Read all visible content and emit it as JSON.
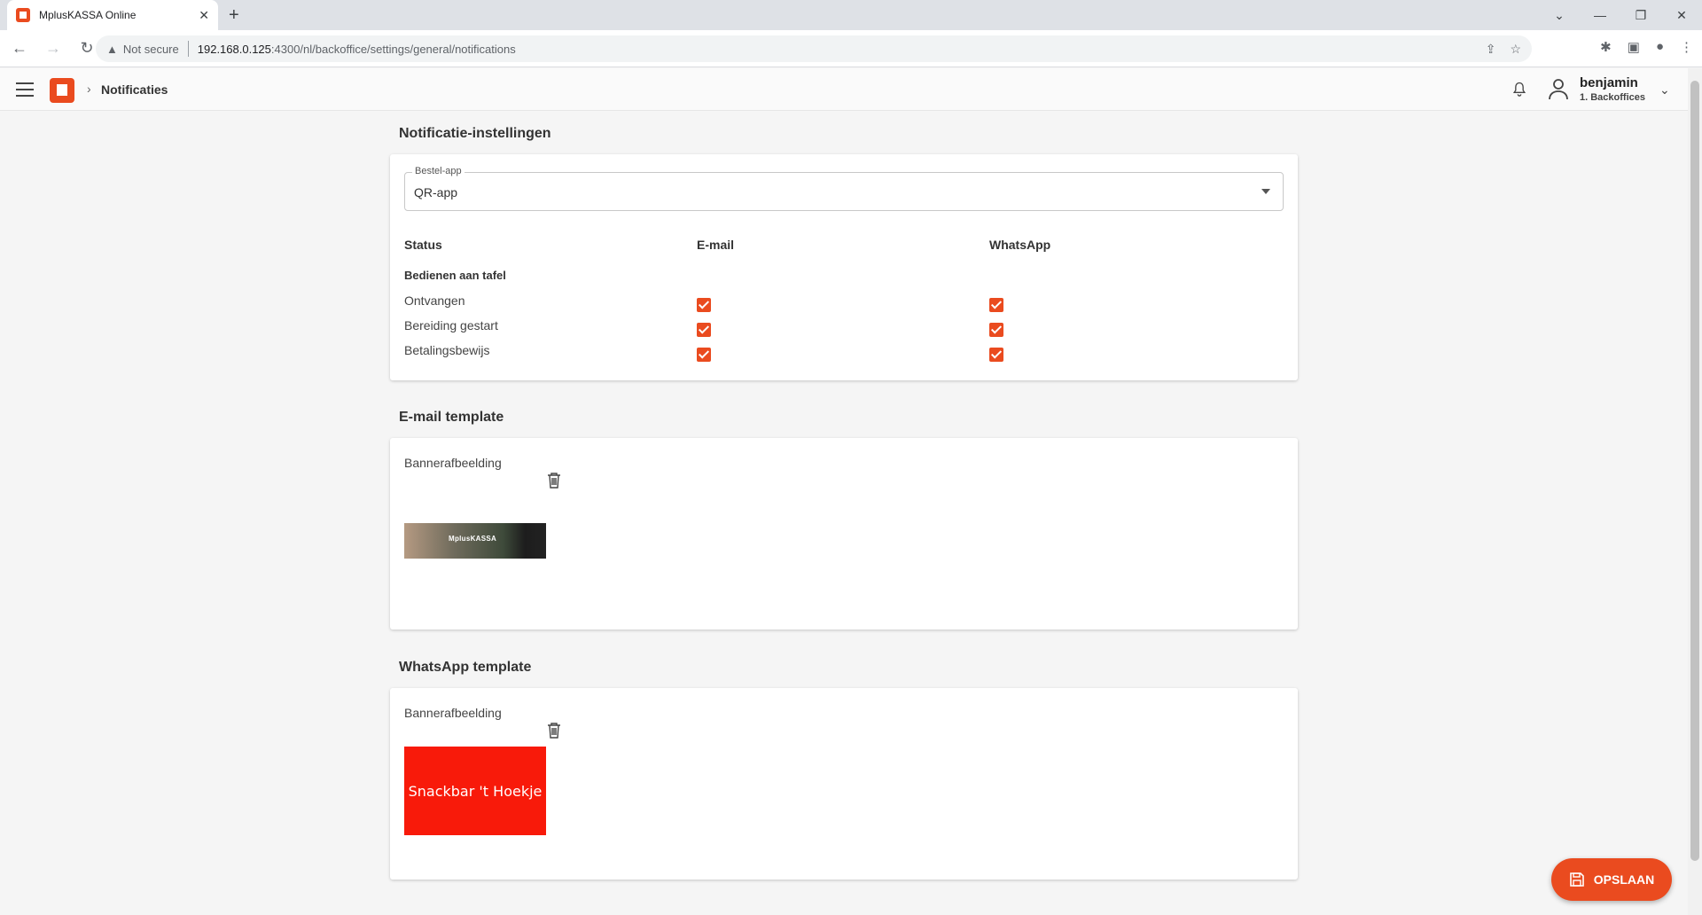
{
  "browser": {
    "tab_title": "MplusKASSA Online",
    "tab_close": "✕",
    "new_tab": "+",
    "not_secure": "Not secure",
    "url_host": "192.168.0.125",
    "url_path": ":4300/nl/backoffice/settings/general/notifications"
  },
  "header": {
    "breadcrumb": "Notificaties",
    "user_name": "benjamin",
    "user_role": "1. Backoffices"
  },
  "notification_settings": {
    "title": "Notificatie-instellingen",
    "select_label": "Bestel-app",
    "select_value": "QR-app",
    "columns": {
      "status": "Status",
      "email": "E-mail",
      "whatsapp": "WhatsApp"
    },
    "group": "Bedienen aan tafel",
    "rows": [
      {
        "label": "Ontvangen",
        "email": true,
        "whatsapp": true
      },
      {
        "label": "Bereiding gestart",
        "email": true,
        "whatsapp": true
      },
      {
        "label": "Betalingsbewijs",
        "email": true,
        "whatsapp": true
      }
    ]
  },
  "email_template": {
    "title": "E-mail template",
    "banner_label": "Bannerafbeelding",
    "banner_text": "MplusKASSA"
  },
  "whatsapp_template": {
    "title": "WhatsApp template",
    "banner_label": "Bannerafbeelding",
    "banner_text": "Snackbar 't Hoekje"
  },
  "save_button": "OPSLAAN",
  "colors": {
    "accent": "#ea4b1f",
    "whatsapp_banner": "#f81a0a"
  }
}
